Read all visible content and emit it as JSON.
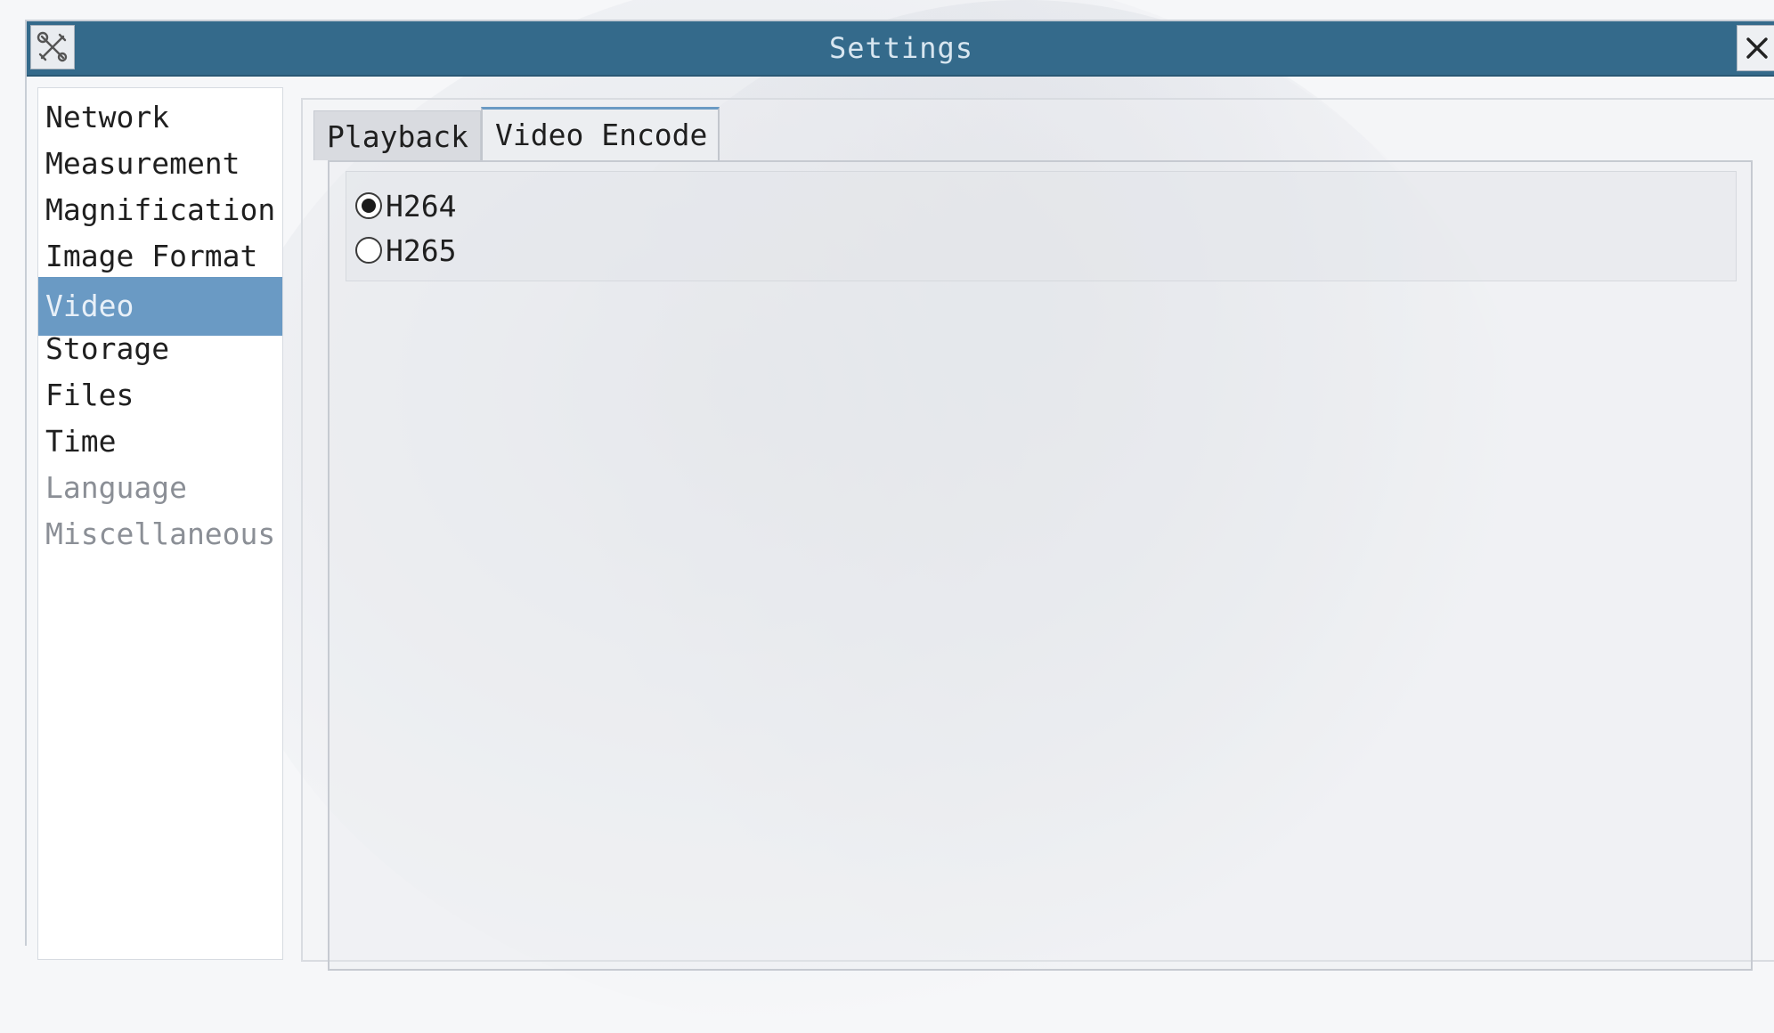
{
  "window": {
    "title": "Settings",
    "app_icon": "tools-icon",
    "close_icon": "close-icon"
  },
  "sidebar": {
    "selected": "Video",
    "items": [
      {
        "label": "Network"
      },
      {
        "label": "Measurement"
      },
      {
        "label": "Magnification"
      },
      {
        "label": "Image Format"
      },
      {
        "label": "Video"
      },
      {
        "label": "Storage"
      },
      {
        "label": "Files"
      },
      {
        "label": "Time"
      },
      {
        "label": "Language"
      },
      {
        "label": "Miscellaneous"
      }
    ]
  },
  "tabs": {
    "active": "Video Encode",
    "items": [
      {
        "label": "Playback"
      },
      {
        "label": "Video Encode"
      }
    ]
  },
  "encode": {
    "options": [
      {
        "label": "H264",
        "checked": true
      },
      {
        "label": "H265",
        "checked": false
      }
    ]
  },
  "colors": {
    "titlebar": "#346a8b",
    "selection": "#6a9ac4"
  }
}
